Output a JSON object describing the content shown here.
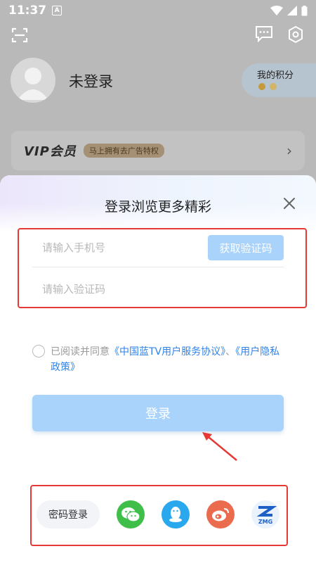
{
  "status": {
    "time": "11:37",
    "notification_letter": "A"
  },
  "profile": {
    "name": "未登录"
  },
  "points": {
    "title": "我的积分"
  },
  "vip": {
    "logo": "VIP会员",
    "badge": "马上拥有去广告特权"
  },
  "login": {
    "title": "登录浏览更多精彩",
    "phone_placeholder": "请输入手机号",
    "get_code_label": "获取验证码",
    "code_placeholder": "请输入验证码",
    "agree_prefix": "已阅读并同意",
    "agree_link1": "《中国蓝TV用户服务协议》",
    "agree_sep": "、",
    "agree_link2": "《用户隐私政策》",
    "login_label": "登录",
    "password_login_label": "密码登录",
    "zmg_label": "ZMG"
  },
  "colors": {
    "accent": "#2f83e8",
    "button_disabled": "#a9d3fb",
    "annotation": "#e53935"
  }
}
